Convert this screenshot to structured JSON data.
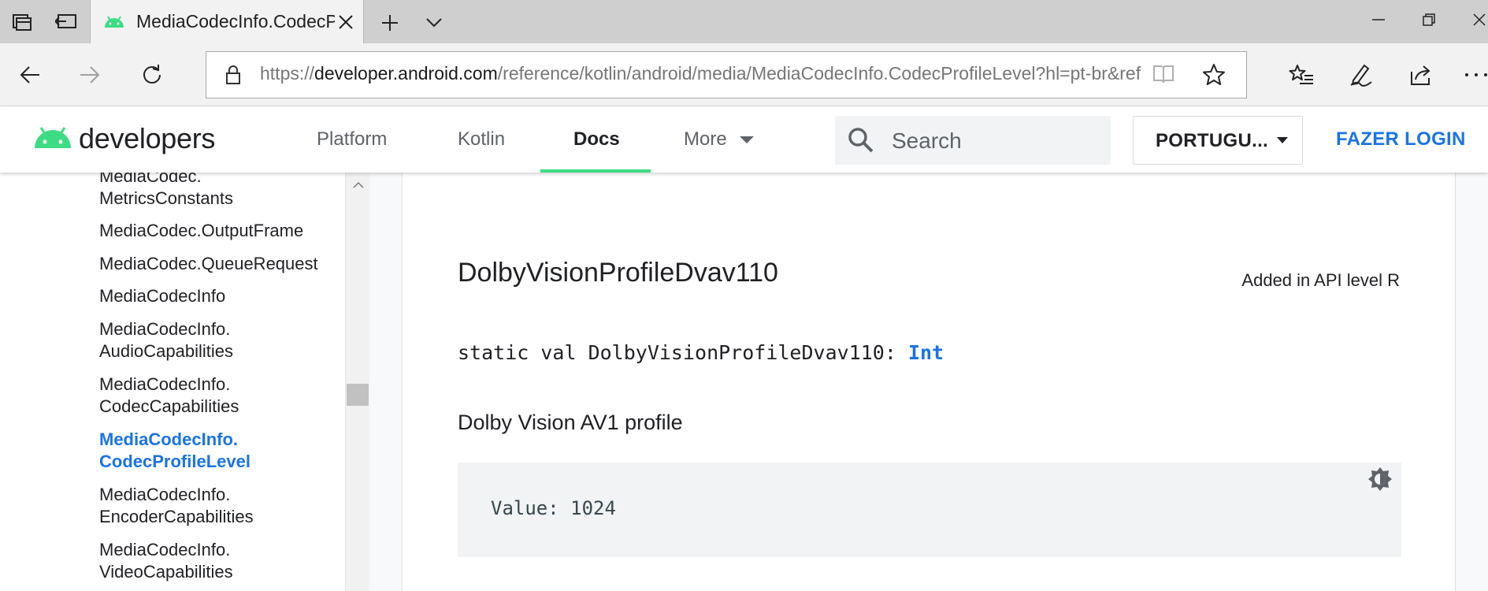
{
  "browser": {
    "tab_title": "MediaCodecInfo.CodecProfileLevel",
    "url_scheme": "https://",
    "url_host": "developer.android.com",
    "url_path": "/reference/kotlin/android/media/MediaCodecInfo.CodecProfileLevel?hl=pt-br&ref"
  },
  "header": {
    "logo_text": "developers",
    "nav": [
      "Platform",
      "Kotlin",
      "Docs",
      "More"
    ],
    "active_nav": "Docs",
    "search_placeholder": "Search",
    "language": "PORTUGU...",
    "login": "FAZER LOGIN"
  },
  "leftnav": {
    "items": [
      {
        "line1": "MediaCodec.",
        "line2": "MetricsConstants"
      },
      {
        "line1": "MediaCodec.OutputFrame",
        "line2": ""
      },
      {
        "line1": "MediaCodec.QueueRequest",
        "line2": ""
      },
      {
        "line1": "MediaCodecInfo",
        "line2": ""
      },
      {
        "line1": "MediaCodecInfo.",
        "line2": "AudioCapabilities"
      },
      {
        "line1": "MediaCodecInfo.",
        "line2": "CodecCapabilities"
      },
      {
        "line1": "MediaCodecInfo.",
        "line2": "CodecProfileLevel",
        "active": true
      },
      {
        "line1": "MediaCodecInfo.",
        "line2": "EncoderCapabilities"
      },
      {
        "line1": "MediaCodecInfo.",
        "line2": "VideoCapabilities"
      }
    ]
  },
  "content": {
    "heading": "DolbyVisionProfileDvav110",
    "api_level": "Added in API level R",
    "signature_prefix": "static val DolbyVisionProfileDvav110: ",
    "signature_type": "Int",
    "description": "Dolby Vision AV1 profile",
    "code": "Value: 1024"
  },
  "colors": {
    "android_green": "#3ddc84",
    "link_blue": "#1a73e8"
  }
}
